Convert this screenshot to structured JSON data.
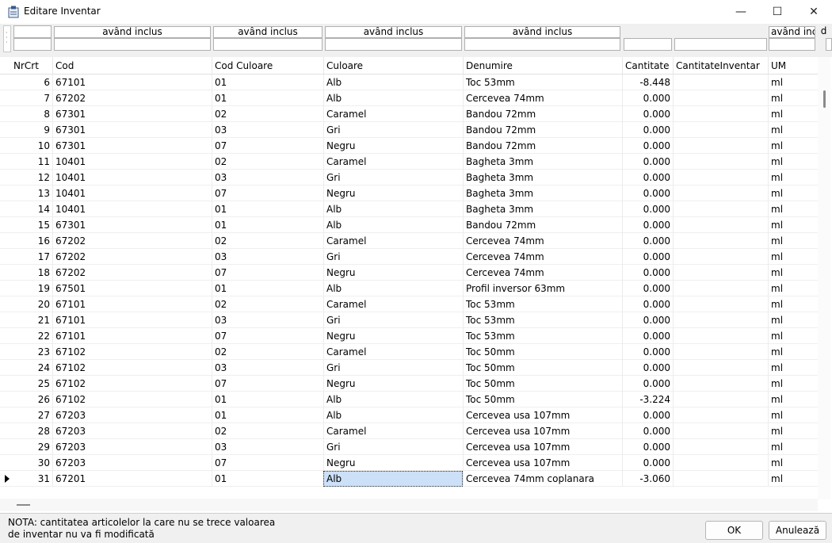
{
  "window": {
    "title": "Editare Inventar",
    "min_glyph": "—",
    "max_glyph": "☐",
    "close_glyph": "✕"
  },
  "filters": {
    "include_label": "având inclus",
    "include_label_cut": "având inclu",
    "extra_glyph": "d"
  },
  "grid": {
    "columns": [
      "NrCrt",
      "Cod",
      "Cod Culoare",
      "Culoare",
      "Denumire",
      "Cantitate",
      "CantitateInventar",
      "UM"
    ],
    "rows": [
      {
        "nr": "6",
        "cod": "67101",
        "cod_culoare": "01",
        "culoare": "Alb",
        "denumire": "Toc 53mm",
        "cantitate": "-8.448",
        "cant_inv": "",
        "um": "ml"
      },
      {
        "nr": "7",
        "cod": "67202",
        "cod_culoare": "01",
        "culoare": "Alb",
        "denumire": "Cercevea 74mm",
        "cantitate": "0.000",
        "cant_inv": "",
        "um": "ml"
      },
      {
        "nr": "8",
        "cod": "67301",
        "cod_culoare": "02",
        "culoare": "Caramel",
        "denumire": "Bandou 72mm",
        "cantitate": "0.000",
        "cant_inv": "",
        "um": "ml"
      },
      {
        "nr": "9",
        "cod": "67301",
        "cod_culoare": "03",
        "culoare": "Gri",
        "denumire": "Bandou 72mm",
        "cantitate": "0.000",
        "cant_inv": "",
        "um": "ml"
      },
      {
        "nr": "10",
        "cod": "67301",
        "cod_culoare": "07",
        "culoare": "Negru",
        "denumire": "Bandou 72mm",
        "cantitate": "0.000",
        "cant_inv": "",
        "um": "ml"
      },
      {
        "nr": "11",
        "cod": "10401",
        "cod_culoare": "02",
        "culoare": "Caramel",
        "denumire": "Bagheta 3mm",
        "cantitate": "0.000",
        "cant_inv": "",
        "um": "ml"
      },
      {
        "nr": "12",
        "cod": "10401",
        "cod_culoare": "03",
        "culoare": "Gri",
        "denumire": "Bagheta 3mm",
        "cantitate": "0.000",
        "cant_inv": "",
        "um": "ml"
      },
      {
        "nr": "13",
        "cod": "10401",
        "cod_culoare": "07",
        "culoare": "Negru",
        "denumire": "Bagheta 3mm",
        "cantitate": "0.000",
        "cant_inv": "",
        "um": "ml"
      },
      {
        "nr": "14",
        "cod": "10401",
        "cod_culoare": "01",
        "culoare": "Alb",
        "denumire": "Bagheta 3mm",
        "cantitate": "0.000",
        "cant_inv": "",
        "um": "ml"
      },
      {
        "nr": "15",
        "cod": "67301",
        "cod_culoare": "01",
        "culoare": "Alb",
        "denumire": "Bandou 72mm",
        "cantitate": "0.000",
        "cant_inv": "",
        "um": "ml"
      },
      {
        "nr": "16",
        "cod": "67202",
        "cod_culoare": "02",
        "culoare": "Caramel",
        "denumire": "Cercevea 74mm",
        "cantitate": "0.000",
        "cant_inv": "",
        "um": "ml"
      },
      {
        "nr": "17",
        "cod": "67202",
        "cod_culoare": "03",
        "culoare": "Gri",
        "denumire": "Cercevea 74mm",
        "cantitate": "0.000",
        "cant_inv": "",
        "um": "ml"
      },
      {
        "nr": "18",
        "cod": "67202",
        "cod_culoare": "07",
        "culoare": "Negru",
        "denumire": "Cercevea 74mm",
        "cantitate": "0.000",
        "cant_inv": "",
        "um": "ml"
      },
      {
        "nr": "19",
        "cod": "67501",
        "cod_culoare": "01",
        "culoare": "Alb",
        "denumire": "Profil inversor 63mm",
        "cantitate": "0.000",
        "cant_inv": "",
        "um": "ml"
      },
      {
        "nr": "20",
        "cod": "67101",
        "cod_culoare": "02",
        "culoare": "Caramel",
        "denumire": "Toc 53mm",
        "cantitate": "0.000",
        "cant_inv": "",
        "um": "ml"
      },
      {
        "nr": "21",
        "cod": "67101",
        "cod_culoare": "03",
        "culoare": "Gri",
        "denumire": "Toc 53mm",
        "cantitate": "0.000",
        "cant_inv": "",
        "um": "ml"
      },
      {
        "nr": "22",
        "cod": "67101",
        "cod_culoare": "07",
        "culoare": "Negru",
        "denumire": "Toc 53mm",
        "cantitate": "0.000",
        "cant_inv": "",
        "um": "ml"
      },
      {
        "nr": "23",
        "cod": "67102",
        "cod_culoare": "02",
        "culoare": "Caramel",
        "denumire": "Toc 50mm",
        "cantitate": "0.000",
        "cant_inv": "",
        "um": "ml"
      },
      {
        "nr": "24",
        "cod": "67102",
        "cod_culoare": "03",
        "culoare": "Gri",
        "denumire": "Toc 50mm",
        "cantitate": "0.000",
        "cant_inv": "",
        "um": "ml"
      },
      {
        "nr": "25",
        "cod": "67102",
        "cod_culoare": "07",
        "culoare": "Negru",
        "denumire": "Toc 50mm",
        "cantitate": "0.000",
        "cant_inv": "",
        "um": "ml"
      },
      {
        "nr": "26",
        "cod": "67102",
        "cod_culoare": "01",
        "culoare": "Alb",
        "denumire": "Toc 50mm",
        "cantitate": "-3.224",
        "cant_inv": "",
        "um": "ml"
      },
      {
        "nr": "27",
        "cod": "67203",
        "cod_culoare": "01",
        "culoare": "Alb",
        "denumire": "Cercevea usa 107mm",
        "cantitate": "0.000",
        "cant_inv": "",
        "um": "ml"
      },
      {
        "nr": "28",
        "cod": "67203",
        "cod_culoare": "02",
        "culoare": "Caramel",
        "denumire": "Cercevea usa 107mm",
        "cantitate": "0.000",
        "cant_inv": "",
        "um": "ml"
      },
      {
        "nr": "29",
        "cod": "67203",
        "cod_culoare": "03",
        "culoare": "Gri",
        "denumire": "Cercevea usa 107mm",
        "cantitate": "0.000",
        "cant_inv": "",
        "um": "ml"
      },
      {
        "nr": "30",
        "cod": "67203",
        "cod_culoare": "07",
        "culoare": "Negru",
        "denumire": "Cercevea usa 107mm",
        "cantitate": "0.000",
        "cant_inv": "",
        "um": "ml"
      },
      {
        "nr": "31",
        "cod": "67201",
        "cod_culoare": "01",
        "culoare": "Alb",
        "denumire": "Cercevea 74mm coplanara",
        "cantitate": "-3.060",
        "cant_inv": "",
        "um": "ml",
        "current": true
      }
    ]
  },
  "footer": {
    "note": "NOTA: cantitatea articolelor la care nu se trece valoarea de inventar nu va fi modificată",
    "ok_label": "OK",
    "cancel_label": "Anulează"
  }
}
